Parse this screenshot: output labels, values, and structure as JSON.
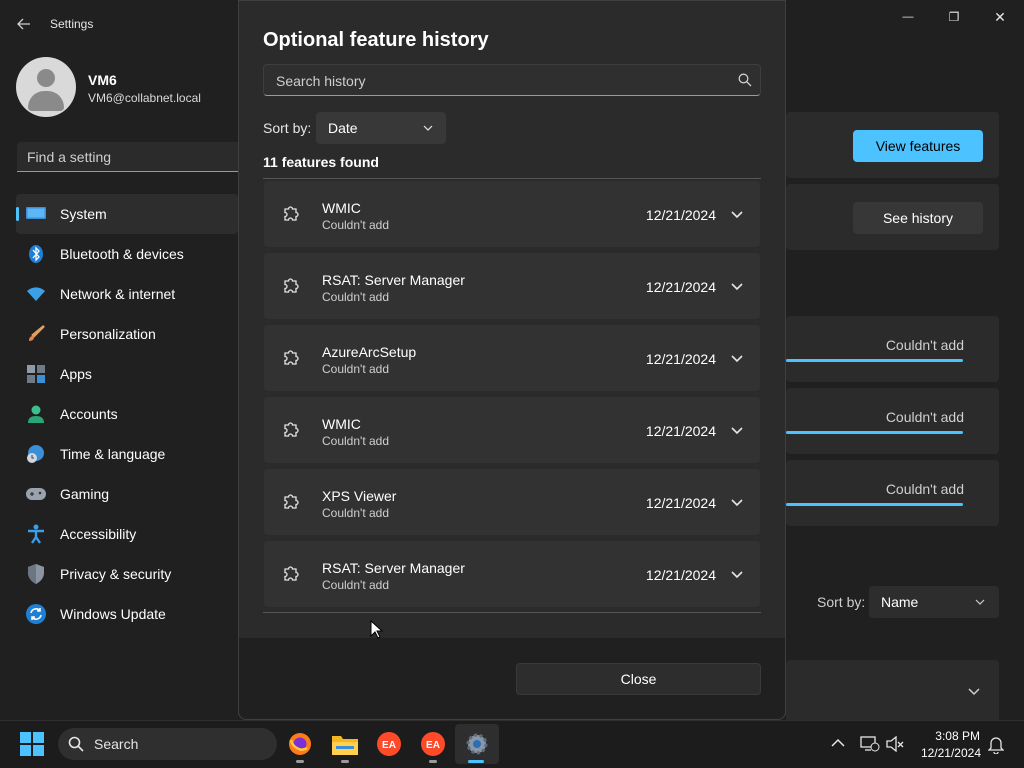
{
  "window": {
    "app_title": "Settings",
    "controls": {
      "minimize": "—",
      "maximize": "❐",
      "close": "✕"
    }
  },
  "profile": {
    "name": "VM6",
    "email": "VM6@collabnet.local"
  },
  "search": {
    "placeholder": "Find a setting"
  },
  "nav": {
    "items": [
      {
        "label": "System",
        "icon": "monitor-icon",
        "active": true
      },
      {
        "label": "Bluetooth & devices",
        "icon": "bluetooth-icon"
      },
      {
        "label": "Network & internet",
        "icon": "wifi-icon"
      },
      {
        "label": "Personalization",
        "icon": "brush-icon"
      },
      {
        "label": "Apps",
        "icon": "apps-icon"
      },
      {
        "label": "Accounts",
        "icon": "person-icon"
      },
      {
        "label": "Time & language",
        "icon": "globe-clock-icon"
      },
      {
        "label": "Gaming",
        "icon": "gamepad-icon"
      },
      {
        "label": "Accessibility",
        "icon": "accessibility-icon"
      },
      {
        "label": "Privacy & security",
        "icon": "shield-icon"
      },
      {
        "label": "Windows Update",
        "icon": "update-icon"
      }
    ]
  },
  "background": {
    "view_features": "View features",
    "see_history": "See history",
    "statuses": [
      "Couldn't add",
      "Couldn't add",
      "Couldn't add"
    ],
    "sort_by_label": "Sort by:",
    "sort_by_value": "Name"
  },
  "dialog": {
    "title": "Optional feature history",
    "search_placeholder": "Search history",
    "sort_label": "Sort by:",
    "sort_value": "Date",
    "found_text": "11 features found",
    "items": [
      {
        "name": "WMIC",
        "status": "Couldn't add",
        "date": "12/21/2024"
      },
      {
        "name": "RSAT: Server Manager",
        "status": "Couldn't add",
        "date": "12/21/2024"
      },
      {
        "name": "AzureArcSetup",
        "status": "Couldn't add",
        "date": "12/21/2024"
      },
      {
        "name": "WMIC",
        "status": "Couldn't add",
        "date": "12/21/2024"
      },
      {
        "name": "XPS Viewer",
        "status": "Couldn't add",
        "date": "12/21/2024"
      },
      {
        "name": "RSAT: Server Manager",
        "status": "Couldn't add",
        "date": "12/21/2024"
      }
    ],
    "close_label": "Close"
  },
  "taskbar": {
    "search_label": "Search",
    "apps": [
      "start-icon",
      "firefox-icon",
      "file-explorer-icon",
      "ea-icon",
      "ea-icon",
      "settings-icon"
    ],
    "time": "3:08 PM",
    "date": "12/21/2024"
  },
  "colors": {
    "accent": "#4cc2ff",
    "background": "#202020",
    "card": "#323232"
  }
}
